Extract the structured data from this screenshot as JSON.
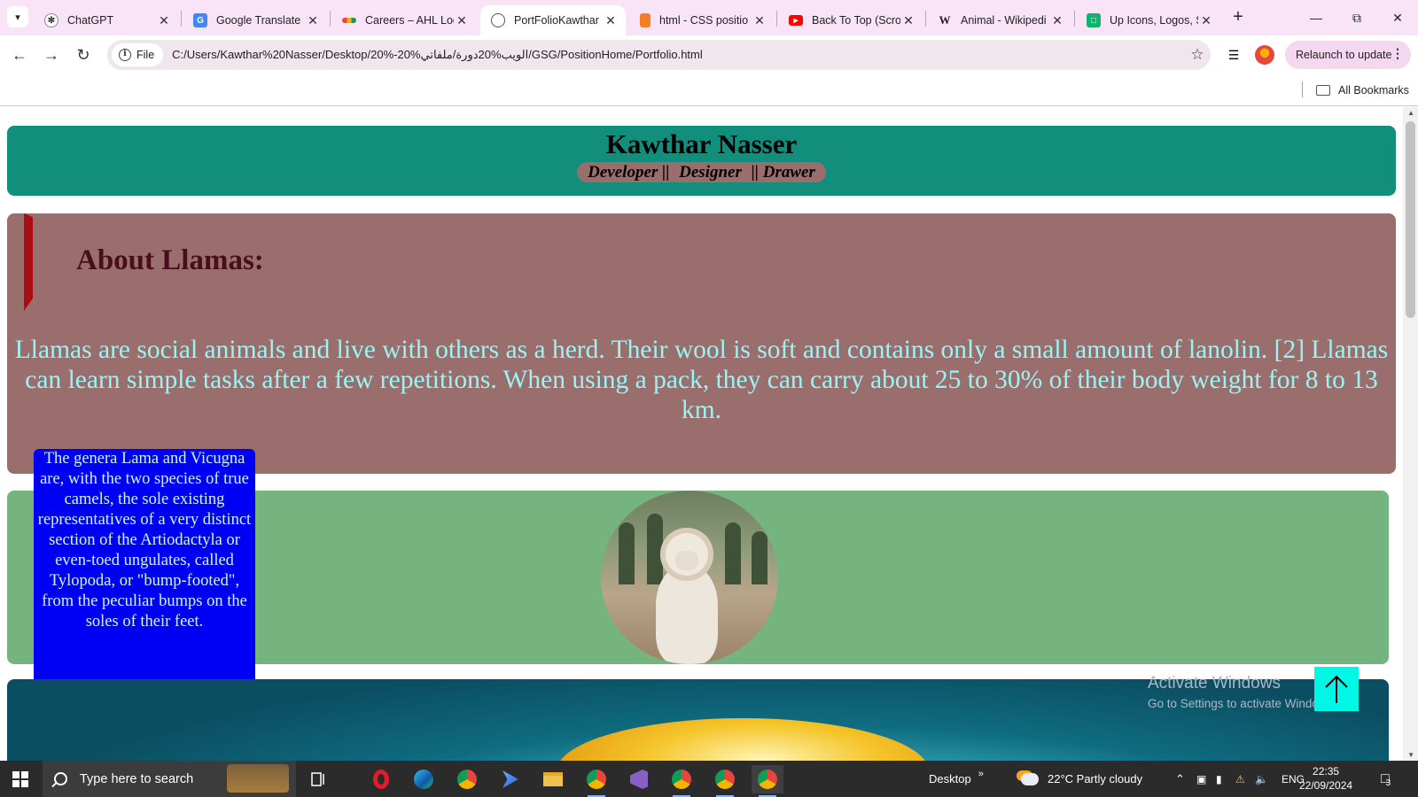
{
  "browser": {
    "tabs": [
      {
        "title": "ChatGPT",
        "icon": "chatgpt-icon"
      },
      {
        "title": "Google Translate",
        "icon": "google-translate-icon"
      },
      {
        "title": "Careers – AHL Log",
        "icon": "ahl-icon"
      },
      {
        "title": "PortFolioKawthar",
        "icon": "globe-icon",
        "active": true
      },
      {
        "title": "html - CSS positio",
        "icon": "stackoverflow-icon"
      },
      {
        "title": "Back To Top (Scrol",
        "icon": "youtube-icon"
      },
      {
        "title": "Animal - Wikipedi",
        "icon": "wikipedia-icon"
      },
      {
        "title": "Up Icons, Logos, S",
        "icon": "flaticon-icon"
      }
    ],
    "file_chip": "File",
    "url": "C:/Users/Kawthar%20Nasser/Desktop/20%-20%الويب%20دورة/ملفاتي/GSG/PositionHome/Portfolio.html",
    "relaunch_label": "Relaunch to update",
    "bookmarks_all": "All Bookmarks"
  },
  "page": {
    "header": {
      "name": "Kawthar Nasser",
      "roles": [
        "Developer ||",
        "Designer",
        "|| Drawer"
      ]
    },
    "about": {
      "title": "About Llamas:",
      "text": "Llamas are social animals and live with others as a herd. Their wool is soft and contains only a small amount of lanolin. [2] Llamas can learn simple tasks after a few repetitions. When using a pack, they can carry about 25 to 30% of their body weight for 8 to 13 km."
    },
    "side_note": "The genera Lama and Vicugna are, with the two species of true camels, the sole existing representatives of a very distinct section of the Artiodactyla or even-toed ungulates, called Tylopoda, or \"bump-footed\", from the peculiar bumps on the soles of their feet.",
    "colors": {
      "header_bg": "#118f7c",
      "about_bg": "#9b6e6e",
      "about_text": "#9bf4f4",
      "green_bg": "#75b47f",
      "note_bg": "#0000f5",
      "to_top_bg": "#00f7e6"
    },
    "back_to_top_icon": "arrow-up-icon"
  },
  "watermark": {
    "line1": "Activate Windows",
    "line2": "Go to Settings to activate Windows."
  },
  "taskbar": {
    "search_placeholder": "Type here to search",
    "desktop_label": "Desktop",
    "weather": "22°C  Partly cloudy",
    "language": "ENG",
    "time": "22:35",
    "date": "22/09/2024",
    "notifications": "3"
  }
}
